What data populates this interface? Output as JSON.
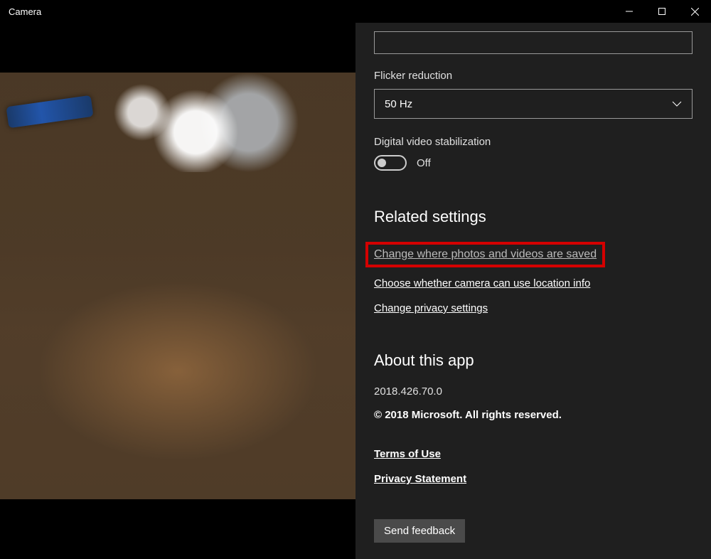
{
  "window": {
    "title": "Camera"
  },
  "settings": {
    "flicker": {
      "label": "Flicker reduction",
      "value": "50 Hz"
    },
    "stabilization": {
      "label": "Digital video stabilization",
      "state": "Off"
    }
  },
  "related": {
    "heading": "Related settings",
    "links": {
      "save_location": "Change where photos and videos are saved",
      "location_info": "Choose whether camera can use location info",
      "privacy": "Change privacy settings"
    }
  },
  "about": {
    "heading": "About this app",
    "version": "2018.426.70.0",
    "copyright": "© 2018 Microsoft. All rights reserved.",
    "terms": "Terms of Use",
    "privacy_statement": "Privacy Statement",
    "feedback": "Send feedback"
  }
}
